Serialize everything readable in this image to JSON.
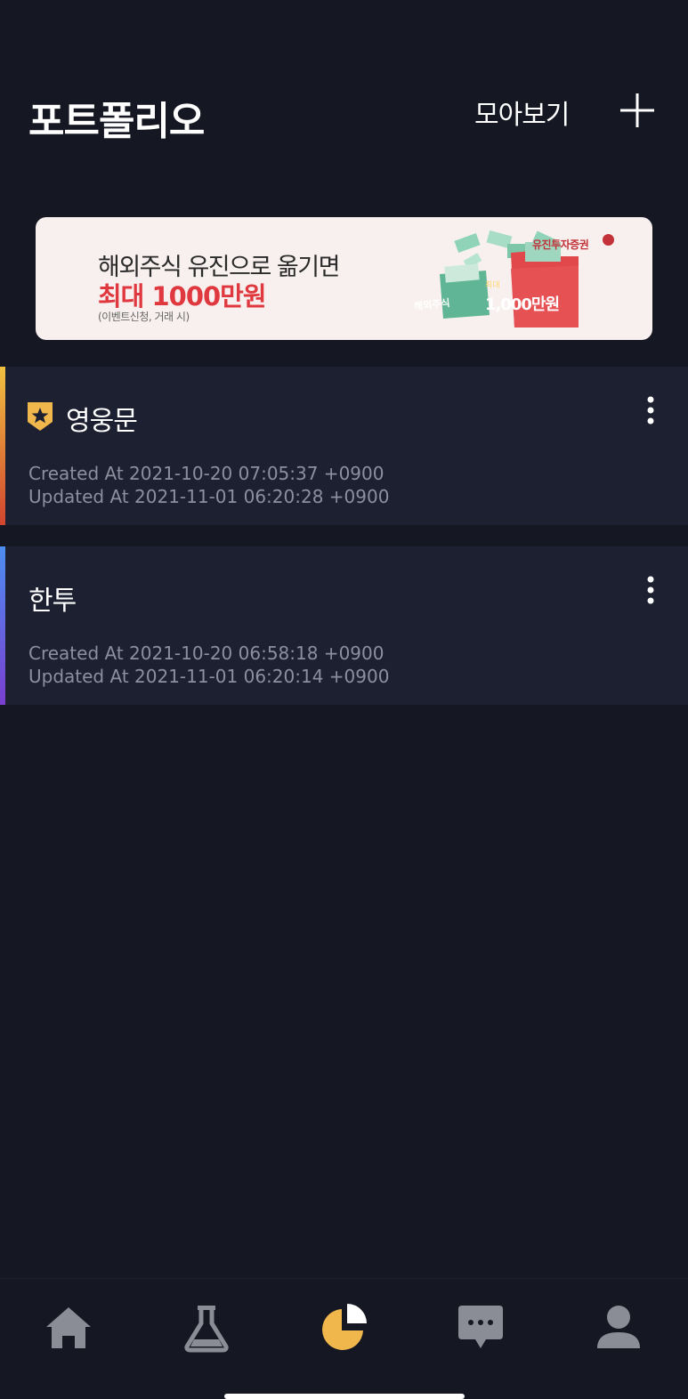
{
  "header": {
    "title": "포트폴리오",
    "overview_label": "모아보기",
    "add_icon": "plus-icon"
  },
  "banner": {
    "line1": "해외주식 유진으로 옮기면",
    "line2": "최대 1000만원",
    "line3": "(이벤트신청, 거래 시)",
    "brand": "유진투자증권",
    "folder_left_label": "해외주식",
    "folder_right_small": "최대",
    "folder_right_amount": "1,000만원"
  },
  "portfolios": [
    {
      "name": "영웅문",
      "badge_icon": "star-shield-icon",
      "created": "Created At 2021-10-20 07:05:37 +0900",
      "updated": "Updated At 2021-11-01 06:20:28 +0900",
      "accent_colors": [
        "#f0c040",
        "#d2452f"
      ]
    },
    {
      "name": "한투",
      "created": "Created At 2021-10-20 06:58:18 +0900",
      "updated": "Updated At 2021-11-01 06:20:14 +0900",
      "accent_colors": [
        "#4d8ef0",
        "#7a3fd0"
      ]
    }
  ],
  "nav": {
    "items": [
      "home-icon",
      "flask-icon",
      "pie-chart-icon",
      "chat-icon",
      "profile-icon"
    ],
    "active": "pie-chart-icon",
    "active_color": "#f0b84c",
    "inactive_color": "#8a8d95"
  },
  "colors": {
    "background": "#151722",
    "card": "#1d2030",
    "banner_accent": "#e0383f"
  }
}
